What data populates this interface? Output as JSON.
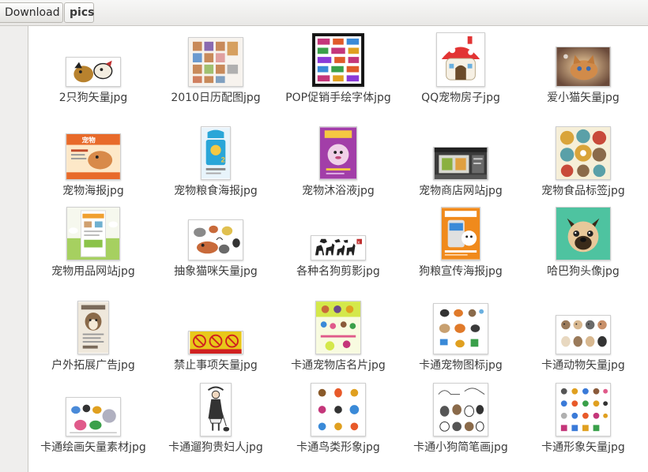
{
  "pathbar": {
    "crumbs": [
      {
        "label": "Download"
      },
      {
        "label": "pics"
      }
    ]
  },
  "files": [
    {
      "name": "2只狗矢量jpg",
      "icon": "two-dogs-thumbnail",
      "accent": "#b8822e"
    },
    {
      "name": "2010日历配图jpg",
      "icon": "calendar-thumbnail",
      "accent": "#c88a5a"
    },
    {
      "name": "POP促销手绘字体jpg",
      "icon": "pop-font-thumbnail",
      "accent": "#c4367a"
    },
    {
      "name": "QQ宠物房子jpg",
      "icon": "pet-house-thumbnail",
      "accent": "#e23434"
    },
    {
      "name": "爱小猫矢量jpg",
      "icon": "kitten-thumbnail",
      "accent": "#d18b4a"
    },
    {
      "name": "宠物海报jpg",
      "icon": "pet-poster-thumbnail",
      "accent": "#e86a2a"
    },
    {
      "name": "宠物粮食海报jpg",
      "icon": "pet-food-poster-thumbnail",
      "accent": "#2aa6d8"
    },
    {
      "name": "宠物沐浴液jpg",
      "icon": "pet-shampoo-thumbnail",
      "accent": "#a23ea8"
    },
    {
      "name": "宠物商店网站jpg",
      "icon": "pet-shop-website-thumbnail",
      "accent": "#5a5a5a"
    },
    {
      "name": "宠物食品标签jpg",
      "icon": "pet-food-labels-thumbnail",
      "accent": "#d9a43a"
    },
    {
      "name": "宠物用品网站jpg",
      "icon": "pet-supplies-website-thumbnail",
      "accent": "#8bc34a"
    },
    {
      "name": "抽象猫咪矢量jpg",
      "icon": "abstract-cats-thumbnail",
      "accent": "#c86a3a"
    },
    {
      "name": "各种名狗剪影jpg",
      "icon": "dog-silhouettes-thumbnail",
      "accent": "#222222"
    },
    {
      "name": "狗粮宣传海报jpg",
      "icon": "dog-food-poster-thumbnail",
      "accent": "#f08a1c"
    },
    {
      "name": "哈巴狗头像jpg",
      "icon": "pug-avatar-thumbnail",
      "accent": "#4ec3a0"
    },
    {
      "name": "户外拓展广告jpg",
      "icon": "outdoor-ad-thumbnail",
      "accent": "#7a6a5a"
    },
    {
      "name": "禁止事项矢量jpg",
      "icon": "prohibition-signs-thumbnail",
      "accent": "#e8c81a"
    },
    {
      "name": "卡通宠物店名片jpg",
      "icon": "pet-shop-card-thumbnail",
      "accent": "#d4e84a"
    },
    {
      "name": "卡通宠物图标jpg",
      "icon": "pet-icons-thumbnail",
      "accent": "#e07a2a"
    },
    {
      "name": "卡通动物矢量jpg",
      "icon": "cartoon-animals-thumbnail",
      "accent": "#9a7a5a"
    },
    {
      "name": "卡通绘画矢量素材jpg",
      "icon": "cartoon-drawing-thumbnail",
      "accent": "#4a8ad8"
    },
    {
      "name": "卡通遛狗贵妇人jpg",
      "icon": "lady-walking-dog-thumbnail",
      "accent": "#333333"
    },
    {
      "name": "卡通鸟类形象jpg",
      "icon": "cartoon-birds-thumbnail",
      "accent": "#e85a2a"
    },
    {
      "name": "卡通小狗简笔画jpg",
      "icon": "puppy-sketch-thumbnail",
      "accent": "#555555"
    },
    {
      "name": "卡通形象矢量jpg",
      "icon": "cartoon-characters-thumbnail",
      "accent": "#3a7ad8"
    }
  ]
}
